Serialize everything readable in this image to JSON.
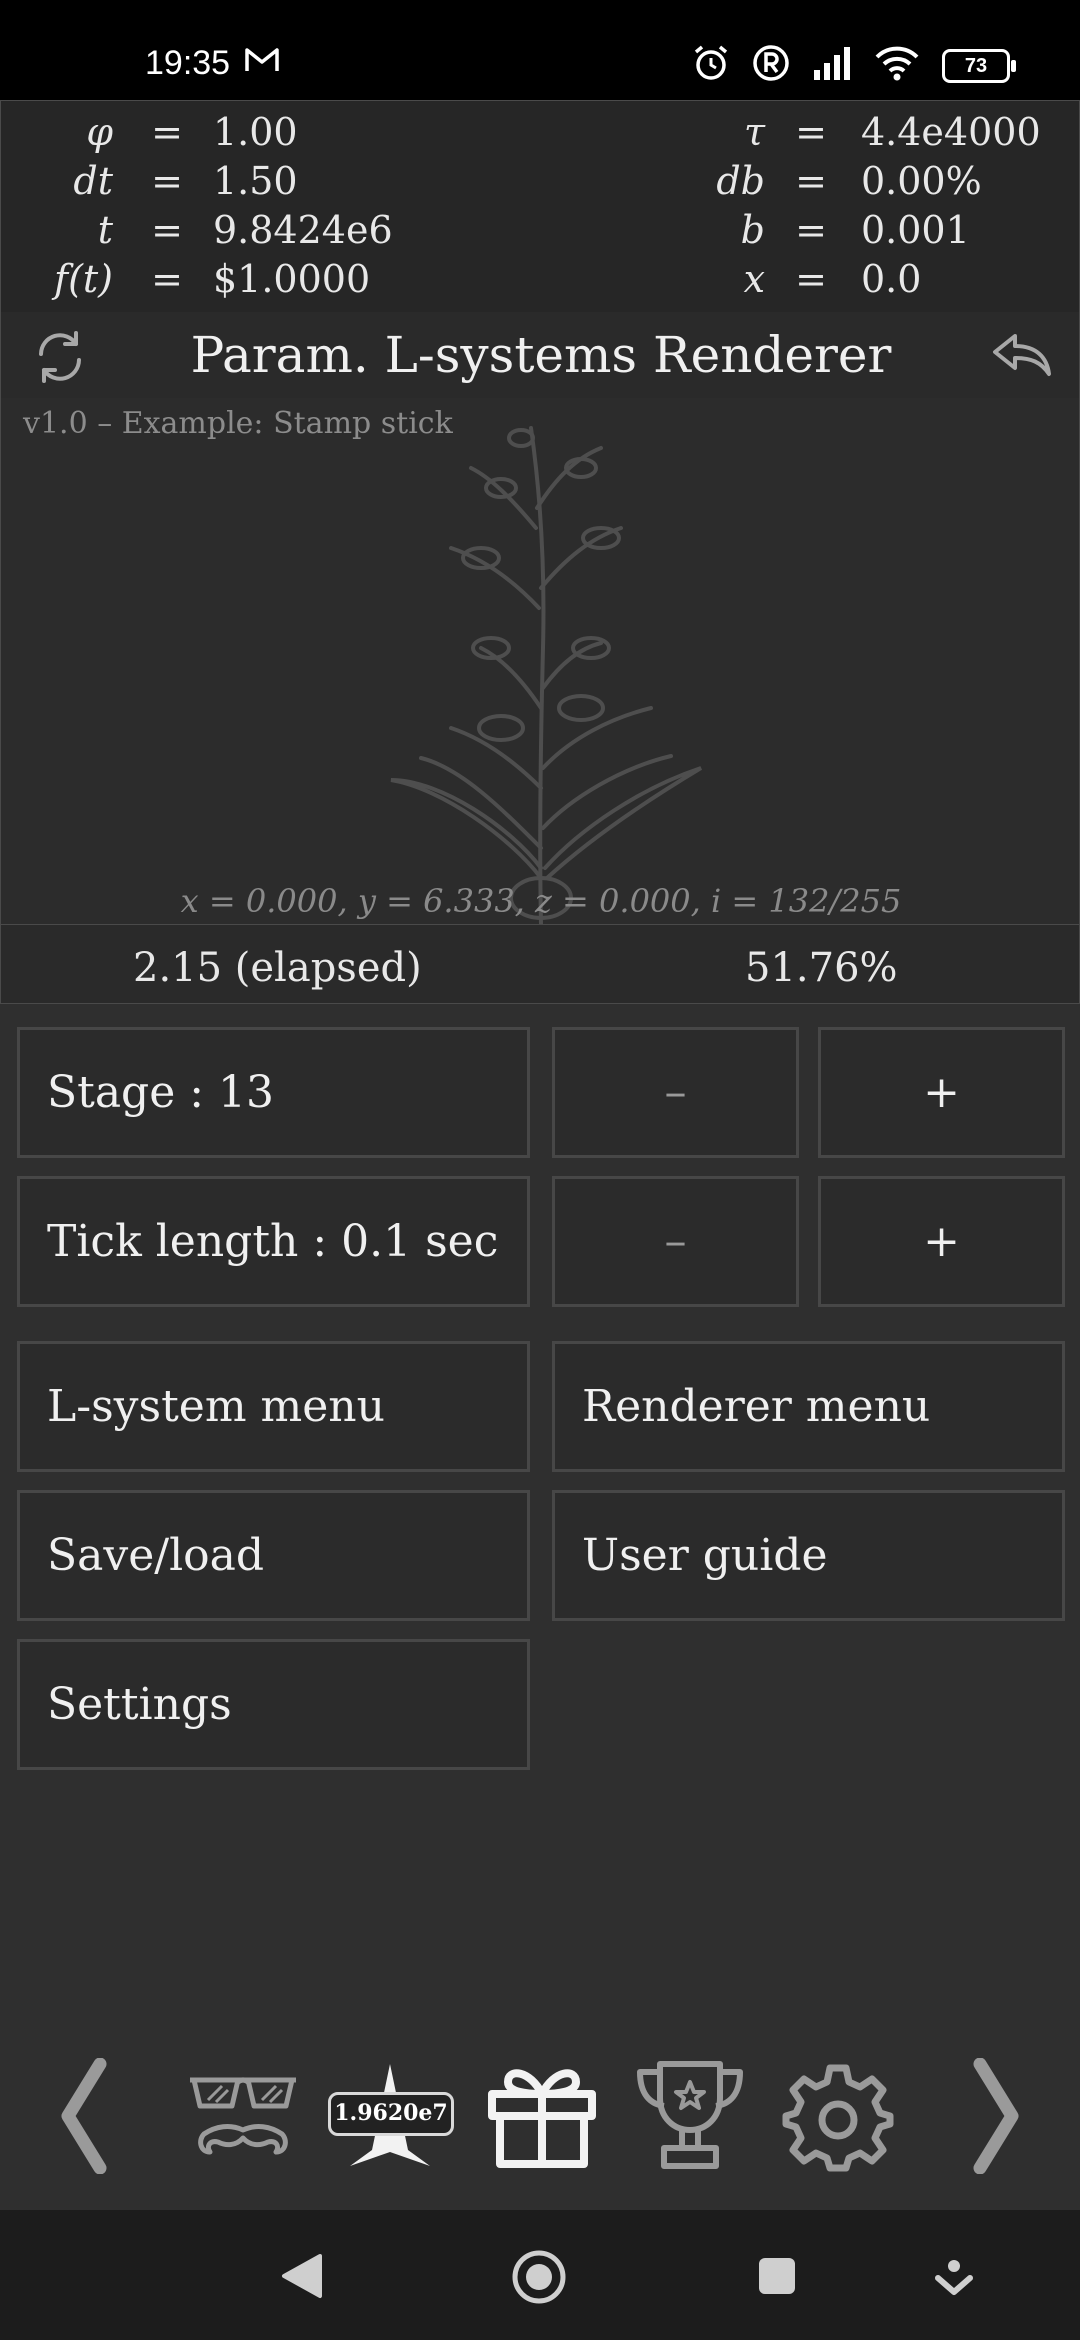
{
  "status_bar": {
    "time": "19:35",
    "battery": "73"
  },
  "variables": {
    "left": [
      {
        "name": "φ",
        "eq": "=",
        "value": "1.00"
      },
      {
        "name": "dt",
        "eq": "=",
        "value": "1.50"
      },
      {
        "name": "t",
        "eq": "=",
        "value": "9.8424e6"
      },
      {
        "name": "f(t)",
        "eq": "=",
        "value": "$1.0000"
      }
    ],
    "right": [
      {
        "name": "τ",
        "eq": "=",
        "value": "4.4e4000"
      },
      {
        "name": "db",
        "eq": "=",
        "value": "0.00%"
      },
      {
        "name": "b",
        "eq": "=",
        "value": "0.001"
      },
      {
        "name": "x",
        "eq": "=",
        "value": "0.0"
      }
    ]
  },
  "header": {
    "title": "Param. L-systems Renderer",
    "left_icon": "refresh-icon",
    "right_icon": "undo-arrow-icon"
  },
  "canvas": {
    "version": "v1.0 – Example: Stamp stick",
    "coords": "x = 0.000,   y = 6.333,   z = 0.000,   i = 132/255"
  },
  "progress": {
    "elapsed": "2.15 (elapsed)",
    "percent": "51.76%"
  },
  "controls": {
    "stage_label": "Stage :  13",
    "tick_label": "Tick length :  0.1 sec",
    "minus": "–",
    "plus": "+"
  },
  "menu": {
    "lsystem": "L-system menu",
    "renderer": "Renderer menu",
    "saveload": "Save/load",
    "guide": "User guide",
    "settings": "Settings"
  },
  "bottom_nav": {
    "star_badge": "1.9620e7",
    "icons": [
      "chevron-left-icon",
      "disguise-glasses-mustache-icon",
      "star-icon",
      "gift-icon",
      "trophy-icon",
      "gear-icon",
      "chevron-right-icon"
    ]
  },
  "colors": {
    "background": "#2f2f2f",
    "panel": "#262626",
    "border": "#474747",
    "text": "#e8e8e8",
    "muted": "#8a8a8a"
  }
}
